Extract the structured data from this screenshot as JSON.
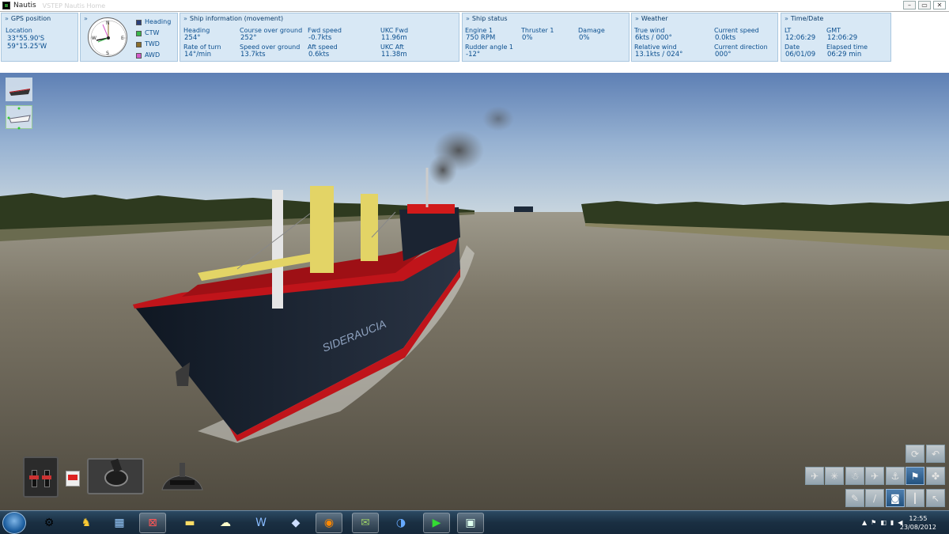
{
  "window": {
    "title": "Nautis",
    "subtitle_ghost": "VSTEP Nautis Home"
  },
  "gps": {
    "header": "GPS position",
    "location_label": "Location",
    "lat": "33°55.90'S",
    "lon": "59°15.25'W"
  },
  "compass_legend": [
    {
      "label": "Heading",
      "color": "#2a3f7a"
    },
    {
      "label": "CTW",
      "color": "#39b54a"
    },
    {
      "label": "TWD",
      "color": "#8a6d2a"
    },
    {
      "label": "AWD",
      "color": "#d35ac9"
    }
  ],
  "compass_letters": {
    "n": "N",
    "s": "S",
    "e": "E",
    "w": "W"
  },
  "ship_movement": {
    "header": "Ship information (movement)",
    "heading_label": "Heading",
    "heading": "254°",
    "rot_label": "Rate of turn",
    "rot": "14°/min",
    "cog_label": "Course over ground",
    "cog": "252°",
    "sog_label": "Speed over ground",
    "sog": "13.7kts",
    "fwd_label": "Fwd speed",
    "fwd": "-0.7kts",
    "aft_label": "Aft speed",
    "aft": "0.6kts",
    "ukc_fwd_label": "UKC Fwd",
    "ukc_fwd": "11.96m",
    "ukc_aft_label": "UKC Aft",
    "ukc_aft": "11.38m"
  },
  "ship_status": {
    "header": "Ship status",
    "engine_label": "Engine 1",
    "engine": "750 RPM",
    "rudder_label": "Rudder angle 1",
    "rudder": "-12°",
    "thruster_label": "Thruster 1",
    "thruster": "0%",
    "damage_label": "Damage",
    "damage": "0%"
  },
  "weather": {
    "header": "Weather",
    "true_wind_label": "True wind",
    "true_wind": "6kts / 000°",
    "rel_wind_label": "Relative wind",
    "rel_wind": "13.1kts / 024°",
    "cur_speed_label": "Current speed",
    "cur_speed": "0.0kts",
    "cur_dir_label": "Current direction",
    "cur_dir": "000°"
  },
  "time": {
    "header": "Time/Date",
    "lt_label": "LT",
    "lt": "12:06:29",
    "gmt_label": "GMT",
    "gmt": "12:06:29",
    "date_label": "Date",
    "date": "06/01/09",
    "elapsed_label": "Elapsed time",
    "elapsed": "06:29 min"
  },
  "ship_name": "SIDERAUCIA",
  "taskbar": {
    "clock_time": "12:55",
    "clock_date": "23/08/2012"
  },
  "colors": {
    "hud_panel": "#d8e8f5",
    "hud_text": "#0b4f8f",
    "hull": "#16202e",
    "deck_red": "#c0141a",
    "crane_yellow": "#e3d466",
    "water": "#6f6a5c"
  }
}
